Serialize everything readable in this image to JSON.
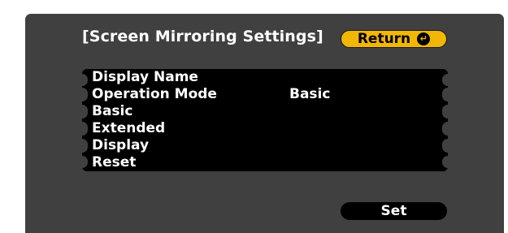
{
  "header": {
    "title": "[Screen Mirroring Settings]",
    "return_label": "Return"
  },
  "menu": {
    "items": [
      {
        "label": "Display Name",
        "value": ""
      },
      {
        "label": "Operation Mode",
        "value": "Basic"
      },
      {
        "label": "Basic",
        "value": ""
      },
      {
        "label": "Extended",
        "value": ""
      },
      {
        "label": "Display",
        "value": ""
      },
      {
        "label": "Reset",
        "value": ""
      }
    ]
  },
  "footer": {
    "set_label": "Set"
  },
  "colors": {
    "panel_background": "#404040",
    "accent": "#f2b705",
    "menu_background": "#000000",
    "text": "#ffffff"
  },
  "icons": {
    "return": "enter-return-icon"
  }
}
